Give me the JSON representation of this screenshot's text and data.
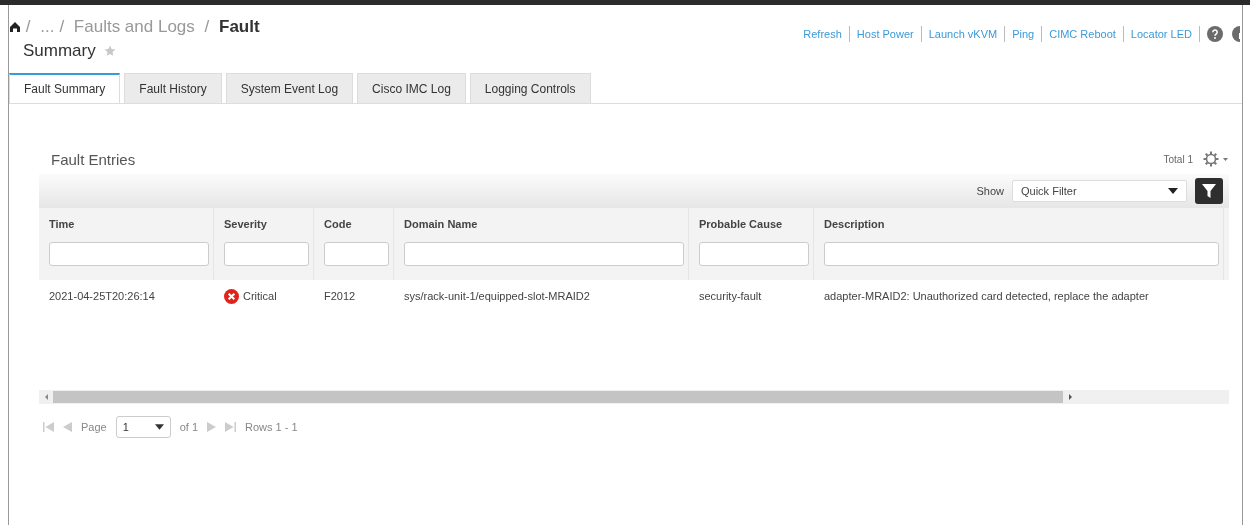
{
  "breadcrumb": {
    "separator": "/",
    "items": [
      "...",
      "Faults and Logs"
    ],
    "current": [
      "Fault",
      "Summary"
    ],
    "favorite": false
  },
  "actions": [
    "Refresh",
    "Host Power",
    "Launch vKVM",
    "Ping",
    "CIMC Reboot",
    "Locator LED"
  ],
  "tabs": [
    {
      "label": "Fault Summary",
      "selected": true
    },
    {
      "label": "Fault History",
      "selected": false
    },
    {
      "label": "System Event Log",
      "selected": false
    },
    {
      "label": "Cisco IMC Log",
      "selected": false
    },
    {
      "label": "Logging Controls",
      "selected": false
    }
  ],
  "panel": {
    "title": "Fault Entries",
    "total": "Total 1",
    "show_label": "Show",
    "filter": "Quick Filter"
  },
  "table": {
    "columns": [
      "Time",
      "Severity",
      "Code",
      "Domain Name",
      "Probable Cause",
      "Description"
    ],
    "rows": [
      {
        "time": "2021-04-25T20:26:14",
        "severity": {
          "kind": "critical",
          "label": "Critical"
        },
        "code": "F2012",
        "domain": "sys/rack-unit-1/equipped-slot-MRAID2",
        "cause": "security-fault",
        "description": "adapter-MRAID2: Unauthorized card detected, replace the adapter"
      }
    ]
  },
  "pager": {
    "page_label": "Page",
    "page": "1",
    "of": "of 1",
    "rows": "Rows 1 - 1"
  }
}
